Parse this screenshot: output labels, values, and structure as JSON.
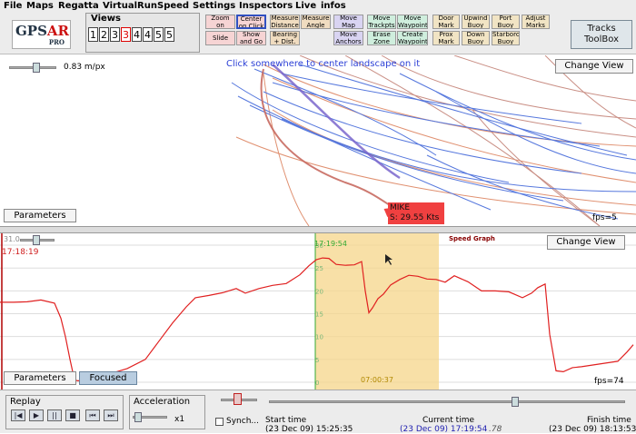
{
  "menu": [
    "File",
    "Maps",
    "Regatta",
    "VirtualRun",
    "Speed",
    "Settings",
    "Inspectors",
    "Live",
    "infos"
  ],
  "logo": {
    "main_prefix": "GPS",
    "main_suffix": "AR",
    "sub": "PRO"
  },
  "views": {
    "title": "Views",
    "buttons": [
      "1",
      "2",
      "3",
      "3",
      "4",
      "4",
      "5",
      "5"
    ],
    "selected_index": 3
  },
  "tools": {
    "zoom_on_mouse": "Zoom on\nMouse",
    "center_on_click": "Center\non Click",
    "slide": "Slide",
    "show_and_go": "Show\nand Go",
    "measure_distance": "Measure\nDistance",
    "measure_angle": "Measure\nAngle",
    "bearing_dist": "Bearing\n+ Dist.",
    "move_map": "Move\nMap",
    "move_anchors": "Move\nAnchors",
    "move_trackpts": "Move\nTrackpts",
    "move_waypoint": "Move\nWaypoint",
    "erase_zone": "Erase\nZone",
    "create_waypoint": "Create\nWaypoint",
    "door_mark": "Door\nMark",
    "prox_mark": "Prox\nMark",
    "upwind_buoy": "Upwind\nBuoy",
    "down_buoy": "Down\nBuoy",
    "port_buoy": "Port\nBuoy",
    "starbord_buoy": "Starbord\nBuoy",
    "adjust_marks": "Adjust\nMarks"
  },
  "tracks_toolbox": {
    "line1": "Tracks",
    "line2": "ToolBox"
  },
  "map": {
    "hint": "Click somewhere to center landscape on it",
    "scale": "0.83 m/px",
    "change_view": "Change View",
    "parameters": "Parameters",
    "boat_name": "MIKE",
    "boat_speed": "S: 29.55 Kts",
    "fps": "fps=5",
    "colors": {
      "track_blue": "#5577dd",
      "track_orange": "#e09070",
      "track_purple": "#7a66cc",
      "boat_label": "#f04040"
    }
  },
  "speed_graph": {
    "title": "Speed Graph",
    "change_view": "Change View",
    "parameters": "Parameters",
    "focused": "Focused",
    "fps": "fps=74",
    "slider_value": "31.0",
    "cursor_time_left": "17:18:19",
    "cursor_time_focus": "17:19:54",
    "focus_duration": "07:00:37"
  },
  "chart_data": {
    "type": "line",
    "title": "Speed Graph",
    "xlabel": "",
    "ylabel": "",
    "ylim": [
      0,
      31
    ],
    "yticks": [
      0,
      5,
      10,
      15,
      20,
      25,
      30
    ],
    "grid": true,
    "series": [
      {
        "color": "#e02020",
        "x": [
          0,
          15,
          30,
          45,
          60,
          67,
          72,
          77,
          82,
          86,
          90,
          100,
          115,
          140,
          160,
          175,
          190,
          205,
          215,
          230,
          245,
          260,
          270,
          285,
          300,
          315,
          330,
          340,
          348,
          355,
          362,
          370,
          380,
          390,
          398,
          402,
          406,
          410,
          416,
          422,
          430,
          440,
          450,
          460,
          470,
          480,
          490,
          500,
          515,
          530,
          545,
          560,
          575,
          585,
          592,
          600,
          605,
          612,
          620,
          630,
          640,
          650,
          660,
          670,
          680,
          690,
          697
        ],
        "y": [
          17.5,
          17.5,
          17.6,
          18,
          17.3,
          14,
          10,
          5,
          0.5,
          0.3,
          0.5,
          0.8,
          1.5,
          3,
          5,
          9,
          13,
          16.5,
          18.5,
          19,
          19.6,
          20.5,
          19.5,
          20.5,
          21.2,
          21.6,
          23.5,
          25.5,
          26.8,
          27.2,
          27.1,
          25.8,
          25.6,
          25.7,
          26.4,
          20,
          15.2,
          16.3,
          18.3,
          19.3,
          21.3,
          22.5,
          23.4,
          23.2,
          22.6,
          22.5,
          21.9,
          23.3,
          22,
          20,
          20,
          19.8,
          18.5,
          19.5,
          20.7,
          21.5,
          10.5,
          2.5,
          2.3,
          3.2,
          3.4,
          3.7,
          4,
          4.3,
          4.6,
          6.6,
          8.2
        ]
      }
    ],
    "focus_band_color": "#f5d58a"
  },
  "bottom": {
    "replay": "Replay",
    "acceleration": "Acceleration",
    "accel_value": "x1",
    "synch": "Synch...",
    "start_label": "Start time",
    "start_value": "(23 Dec 09) 15:25:35",
    "current_label": "Current time",
    "current_value": "(23 Dec 09) 17:19:54",
    "current_fraction": ".78",
    "finish_label": "Finish time",
    "finish_value": "(23 Dec 09) 18:13:53",
    "replay_buttons": [
      "|◀",
      "▶",
      "||",
      "■",
      "⏮",
      "⏭"
    ]
  }
}
